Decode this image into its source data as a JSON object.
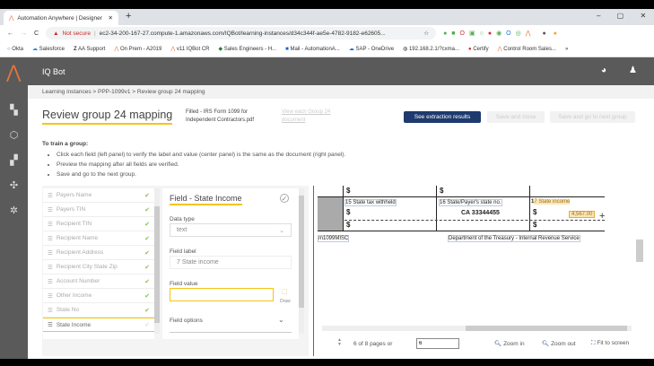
{
  "browser": {
    "tab_title": "Automation Anywhere | Designer",
    "new_tab": "+",
    "not_secure": "Not secure",
    "url": "ec2-34-200-167-27.compute-1.amazonaws.com/IQBot/learning-instances/d34c344f-ae5e-4782-9182-e62605...",
    "bookmarks": [
      "Okta",
      "Salesforce",
      "AA Support",
      "On Prem - A2019",
      "v11 IQBot CR",
      "Sales Engineers - H...",
      "Mail - AutomationA...",
      "SAP - OneDrive",
      "192.168.2.1/?cxma...",
      "Certify",
      "Control Room Sales..."
    ],
    "more": "»"
  },
  "app": {
    "title": "IQ Bot"
  },
  "breadcrumb": [
    "Learning instances",
    "PPP-1099v1",
    "Review group 24 mapping"
  ],
  "page": {
    "title": "Review group 24 mapping",
    "file": "Filled - IRS Form 1099 for Independent Contractors.pdf",
    "view_link": "View each Group 24 document",
    "see_results": "See extraction results",
    "save_close": "Save and close",
    "save_next": "Save and go to next group"
  },
  "instructions": {
    "heading": "To train a group:",
    "items": [
      "Click each field (left panel) to verify the label and value (center panel) is the same as the document (right panel).",
      "Preview the mapping after all fields are verified.",
      "Save and go to the next group."
    ]
  },
  "fields": [
    {
      "name": "Payers Name"
    },
    {
      "name": "Payers TIN"
    },
    {
      "name": "Recipient TIN"
    },
    {
      "name": "Recipient Name"
    },
    {
      "name": "Recipient Address"
    },
    {
      "name": "Recipient City State Zip"
    },
    {
      "name": "Account Number"
    },
    {
      "name": "Other Income"
    },
    {
      "name": "State No"
    },
    {
      "name": "State Income"
    }
  ],
  "detail": {
    "title": "Field - State Income",
    "data_type_label": "Data type",
    "data_type": "text",
    "field_label_label": "Field label",
    "field_label": "7 State income",
    "field_value_label": "Field value",
    "field_value": "",
    "draw": "Draw",
    "options": "Field options"
  },
  "doc": {
    "dollar": "$",
    "box15": "15 State tax withheld",
    "box16": "16 State/Payer's state no.",
    "box16_value": "CA 33344455",
    "box17_num": "1",
    "box17": "7 State income",
    "box17_value": "4,567.00",
    "form": "m1099MISC",
    "dept": "Department of the Treasury - Internal Revenue Service"
  },
  "pager": {
    "pages": "6 of 8 pages or",
    "page_input": "6",
    "zoom_in": "Zoom in",
    "zoom_out": "Zoom out",
    "fit": "Fit to screen"
  },
  "colors": {
    "accent": "#f5c518",
    "primary": "#1e3a6e",
    "header": "#5a5a5a"
  }
}
